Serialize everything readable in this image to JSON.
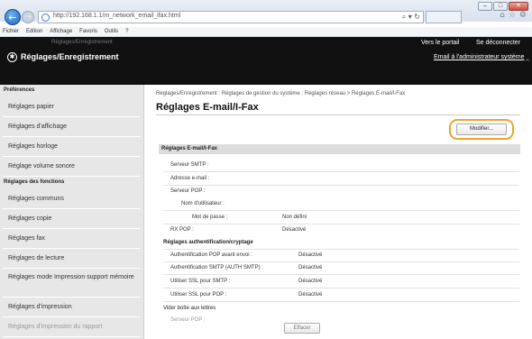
{
  "browser": {
    "url": "http://192.168.1.1/m_network_email_ifax.html",
    "menu": [
      "Fichier",
      "Edition",
      "Affichage",
      "Favoris",
      "Outils",
      "?"
    ],
    "win_controls": [
      "–",
      "□",
      "✕"
    ]
  },
  "header": {
    "status_text": "Réglages/Enregistrement",
    "portal_link": "Vers le portail",
    "logout_link": "Se déconnecter",
    "admin_mail_link": "Email à l'administrateur système",
    "app_title": "Réglages/Enregistrement",
    "app_icon": "settings-icon"
  },
  "sidebar": {
    "sections": [
      {
        "heading": "Préférences",
        "items": [
          "Réglages papier",
          "Réglages d'affichage",
          "Réglages horloge",
          "Réglage volume sonore"
        ]
      },
      {
        "heading": "Réglages des fonctions",
        "items": [
          "Réglages communs",
          "Réglages copie",
          "Réglages fax",
          "Réglages de lecture",
          "Réglages mode Impression support mémoire",
          "Réglages d'impression",
          "Réglages d'impression du rapport"
        ]
      }
    ]
  },
  "main": {
    "breadcrumb": "Réglages/Enregistrement : Réglages de gestion du système : Réglages réseau > Réglages E-mail/I-Fax",
    "title": "Réglages E-mail/I-Fax",
    "modify_button": "Modifier...",
    "section_title": "Réglages E-mail/I-Fax",
    "smtp_server": {
      "label": "Serveur SMTP :",
      "value": ""
    },
    "email_address": {
      "label": "Adresse e-mail :",
      "value": ""
    },
    "pop_server": {
      "label": "Serveur POP :",
      "value": ""
    },
    "username": {
      "label": "Nom d'utilisateur :",
      "value": ""
    },
    "password": {
      "label": "Mot de passe :",
      "value": "Non défini"
    },
    "rx_pop": {
      "label": "RX POP :",
      "value": "Désactivé"
    },
    "auth_heading": "Réglages authentification/cryptage",
    "auth_rows": [
      {
        "label": "Authentification POP avant envoi :",
        "value": "Désactivé"
      },
      {
        "label": "Authentification SMTP (AUTH SMTP) :",
        "value": "Désactivé"
      },
      {
        "label": "Utiliser SSL pour SMTP :",
        "value": "Désactivé"
      },
      {
        "label": "Utiliser SSL pour POP :",
        "value": "Désactivé"
      }
    ],
    "mailbox_heading": "Vider boîte aux lettres",
    "mailbox_pop_label": "Serveur POP :",
    "erase_button": "Effacer"
  }
}
